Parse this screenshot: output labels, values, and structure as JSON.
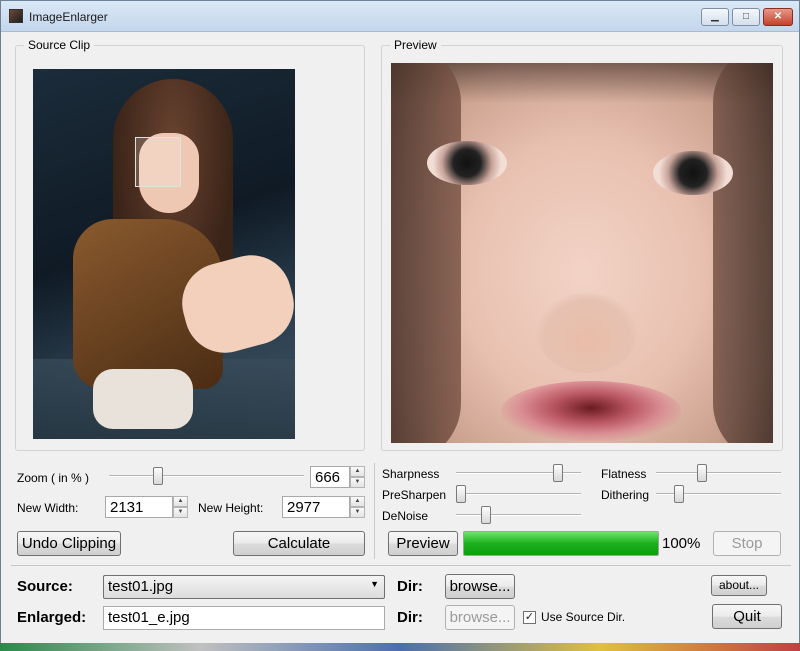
{
  "window": {
    "title": "ImageEnlarger",
    "controls": {
      "minimize": "▁",
      "maximize": "□",
      "close": "✕"
    }
  },
  "source_clip": {
    "title": "Source Clip"
  },
  "preview": {
    "title": "Preview"
  },
  "zoom": {
    "label": "Zoom ( in % )",
    "value": "666"
  },
  "size": {
    "width_label": "New Width:",
    "width": "2131",
    "height_label": "New Height:",
    "height": "2977"
  },
  "buttons": {
    "undo_clipping": "Undo Clipping",
    "calculate": "Calculate",
    "preview": "Preview",
    "stop": "Stop",
    "browse_source": "browse...",
    "browse_enlarged": "browse...",
    "about": "about...",
    "quit": "Quit"
  },
  "sliders": {
    "sharpness": {
      "label": "Sharpness",
      "level": 0.84
    },
    "presharpen": {
      "label": "PreSharpen",
      "level": 0.0
    },
    "denoise": {
      "label": "DeNoise",
      "level": 0.22
    },
    "flatness": {
      "label": "Flatness",
      "level": 0.36
    },
    "dithering": {
      "label": "Dithering",
      "level": 0.16
    },
    "zoom": {
      "level": 0.24
    }
  },
  "progress": {
    "value_text": "100%",
    "level": 1.0
  },
  "files": {
    "source_label": "Source:",
    "source_value": "test01.jpg",
    "enlarged_label": "Enlarged:",
    "enlarged_value": "test01_e.jpg",
    "dir_label_1": "Dir:",
    "dir_label_2": "Dir:",
    "use_source_dir": "Use Source Dir.",
    "use_source_dir_checked": true
  },
  "icons": {
    "spin_up": "▲",
    "spin_down": "▼",
    "combo_arrow": "▼",
    "check": "✓"
  }
}
